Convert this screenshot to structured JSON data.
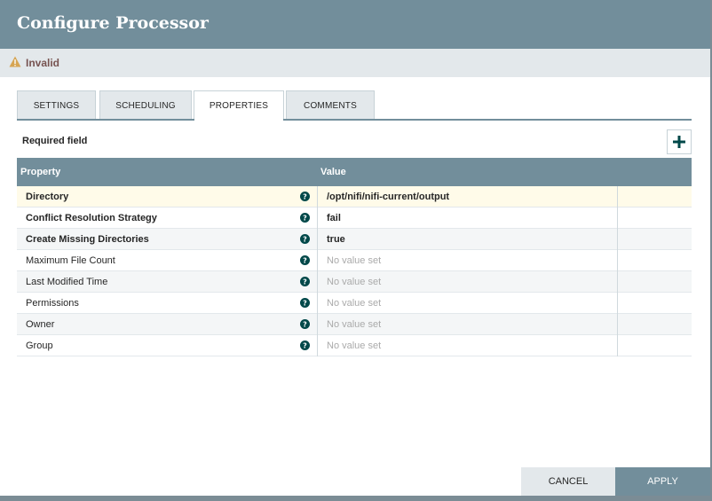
{
  "dialog": {
    "title": "Configure Processor",
    "status": "Invalid"
  },
  "tabs": [
    {
      "label": "SETTINGS"
    },
    {
      "label": "SCHEDULING"
    },
    {
      "label": "PROPERTIES",
      "active": true
    },
    {
      "label": "COMMENTS"
    }
  ],
  "properties_panel": {
    "required_label": "Required field",
    "add_icon": "plus-icon",
    "columns": {
      "property": "Property",
      "value": "Value"
    },
    "rows": [
      {
        "name": "Directory",
        "value": "/opt/nifi/nifi-current/output",
        "required": true,
        "selected": true
      },
      {
        "name": "Conflict Resolution Strategy",
        "value": "fail",
        "required": true
      },
      {
        "name": "Create Missing Directories",
        "value": "true",
        "required": true
      },
      {
        "name": "Maximum File Count",
        "value": "No value set",
        "required": false
      },
      {
        "name": "Last Modified Time",
        "value": "No value set",
        "required": false
      },
      {
        "name": "Permissions",
        "value": "No value set",
        "required": false
      },
      {
        "name": "Owner",
        "value": "No value set",
        "required": false
      },
      {
        "name": "Group",
        "value": "No value set",
        "required": false
      }
    ]
  },
  "footer": {
    "cancel_label": "CANCEL",
    "apply_label": "APPLY"
  },
  "colors": {
    "header_bg": "#728e9b",
    "status_bg": "#e3e8eb",
    "warning": "#d6a553",
    "help_icon": "#004849",
    "selected_row": "#fffbe9",
    "unset_text": "#aaaaaa"
  }
}
